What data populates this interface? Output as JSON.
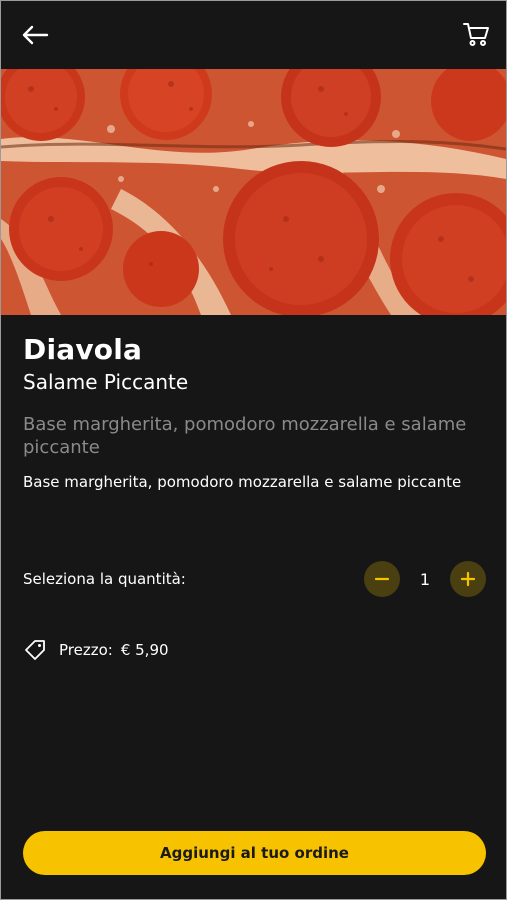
{
  "header": {
    "back_icon": "arrow-left-icon",
    "cart_icon": "cart-icon"
  },
  "product": {
    "image": "pepperoni-pizza-photo",
    "name": "Diavola",
    "subtitle": "Salame Piccante",
    "description_grey": "Base margherita, pomodoro mozzarella e salame piccante",
    "description_white": "Base margherita, pomodoro mozzarella e salame piccante"
  },
  "quantity": {
    "label": "Seleziona la quantità:",
    "value": "1",
    "minus_icon": "minus-icon",
    "plus_icon": "plus-icon"
  },
  "price": {
    "icon": "price-tag-icon",
    "label": "Prezzo:",
    "value": "€ 5,90"
  },
  "cta": {
    "label": "Aggiungi al tuo ordine"
  },
  "colors": {
    "background": "#161616",
    "accent": "#f7c300",
    "qty_button_bg": "#4a3f10",
    "muted_text": "#8a8a8a"
  }
}
